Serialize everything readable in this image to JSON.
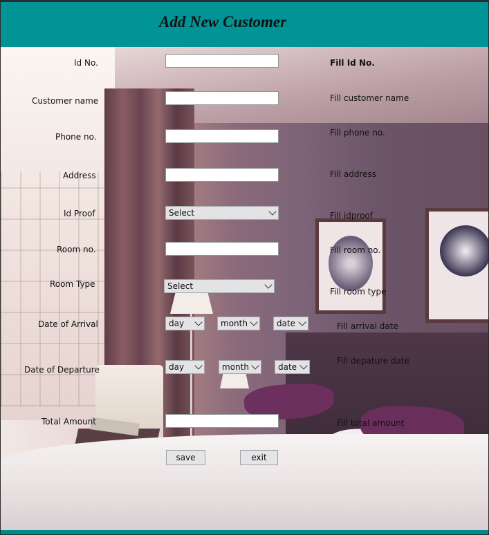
{
  "header": {
    "title": "Add New Customer"
  },
  "form": {
    "fields": {
      "id_no": {
        "label": "Id No.",
        "value": "",
        "hint": "Fill Id No."
      },
      "customer_name": {
        "label": "Customer name",
        "value": "",
        "hint": "Fill customer name"
      },
      "phone_no": {
        "label": "Phone no.",
        "value": "",
        "hint": "Fill phone no."
      },
      "address": {
        "label": "Address",
        "value": "",
        "hint": "Fill address"
      },
      "id_proof": {
        "label": "Id Proof",
        "selected": "Select",
        "hint": "Fill idproof"
      },
      "room_no": {
        "label": "Room no.",
        "value": "",
        "hint": "Fill room no."
      },
      "room_type": {
        "label": "Room Type",
        "selected": "Select",
        "hint": "Fill room type"
      },
      "arrival": {
        "label": "Date of Arrival",
        "day": "day",
        "month": "month",
        "date": "date",
        "hint": "Fill arrival date"
      },
      "departure": {
        "label": "Date of Departure",
        "day": "day",
        "month": "month",
        "date": "date",
        "hint": "Fill depature date"
      },
      "total_amount": {
        "label": "Total Amount",
        "value": "",
        "hint": "Fill total amount"
      }
    },
    "buttons": {
      "save": "save",
      "exit": "exit"
    }
  },
  "colors": {
    "header_bg": "#009496",
    "title_text": "#111111"
  }
}
